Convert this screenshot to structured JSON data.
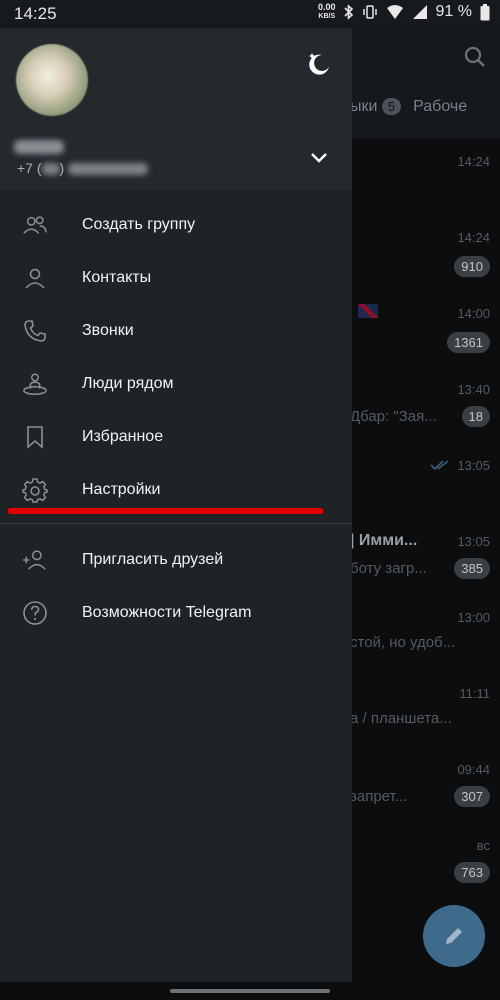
{
  "status_bar": {
    "time": "14:25",
    "net_speed_value": "0.00",
    "net_speed_unit": "KB/S",
    "battery": "91 %"
  },
  "background": {
    "tabs": [
      {
        "label": "ыки",
        "badge": "5"
      },
      {
        "label": "Рабоче"
      }
    ],
    "rows": [
      {
        "time": "14:24"
      },
      {
        "time": "14:24",
        "count": "910"
      },
      {
        "time": "14:00",
        "count": "1361"
      },
      {
        "time": "13:40",
        "preview": "Дбар: \"Зая...",
        "count": "18"
      },
      {
        "time": "13:05"
      },
      {
        "time": "13:05",
        "name": "| Имми...",
        "preview": "боту загр...",
        "count": "385"
      },
      {
        "time": "13:00",
        "preview": "стой, но удоб..."
      },
      {
        "time": "11:11",
        "preview": "а / планшета..."
      },
      {
        "time": "09:44",
        "preview": "запрет...",
        "count": "307"
      },
      {
        "time": "вс",
        "count": "763"
      }
    ]
  },
  "drawer": {
    "phone_prefix": "+7 (",
    "phone_mid": ")",
    "menu": [
      {
        "label": "Создать группу",
        "icon": "group-icon"
      },
      {
        "label": "Контакты",
        "icon": "contact-icon"
      },
      {
        "label": "Звонки",
        "icon": "phone-icon"
      },
      {
        "label": "Люди рядом",
        "icon": "people-nearby-icon"
      },
      {
        "label": "Избранное",
        "icon": "bookmark-icon"
      },
      {
        "label": "Настройки",
        "icon": "gear-icon"
      }
    ],
    "menu2": [
      {
        "label": "Пригласить друзей",
        "icon": "add-user-icon"
      },
      {
        "label": "Возможности Telegram",
        "icon": "question-icon"
      }
    ]
  },
  "colors": {
    "highlight": "#e00000",
    "drawer_bg": "#1f2327",
    "fab": "#3e6a8c"
  }
}
